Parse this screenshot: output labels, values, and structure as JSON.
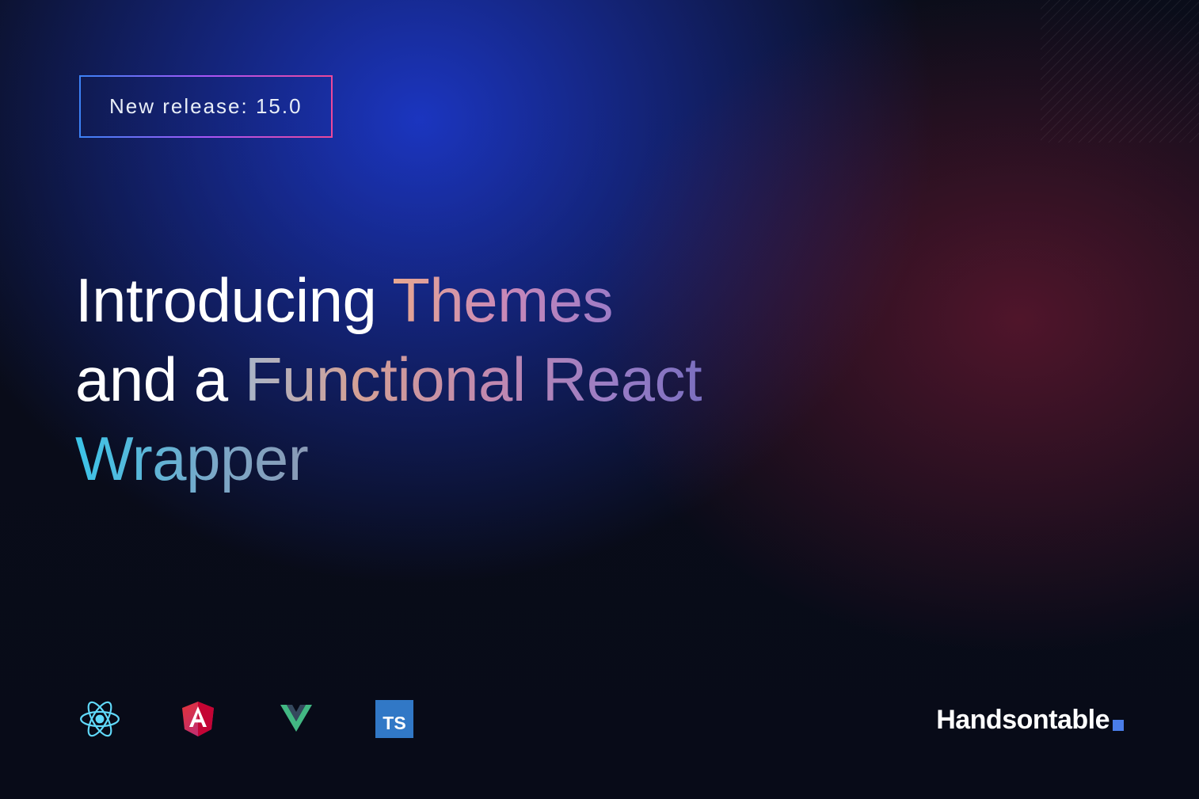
{
  "badge": {
    "label": "New release: 15.0"
  },
  "headline": {
    "part1": "Introducing ",
    "part2": "Themes",
    "part3": "and a ",
    "part4": "Functional React",
    "part5": "Wrapper"
  },
  "tech_icons": [
    {
      "name": "react-icon",
      "color": "#61dafb"
    },
    {
      "name": "angular-icon",
      "color": "#dd0031"
    },
    {
      "name": "vue-icon",
      "color": "#42b883"
    },
    {
      "name": "typescript-icon",
      "color": "#3178c6",
      "label": "TS"
    }
  ],
  "brand": {
    "name": "Handsontable",
    "accent_color": "#4a7de8"
  }
}
